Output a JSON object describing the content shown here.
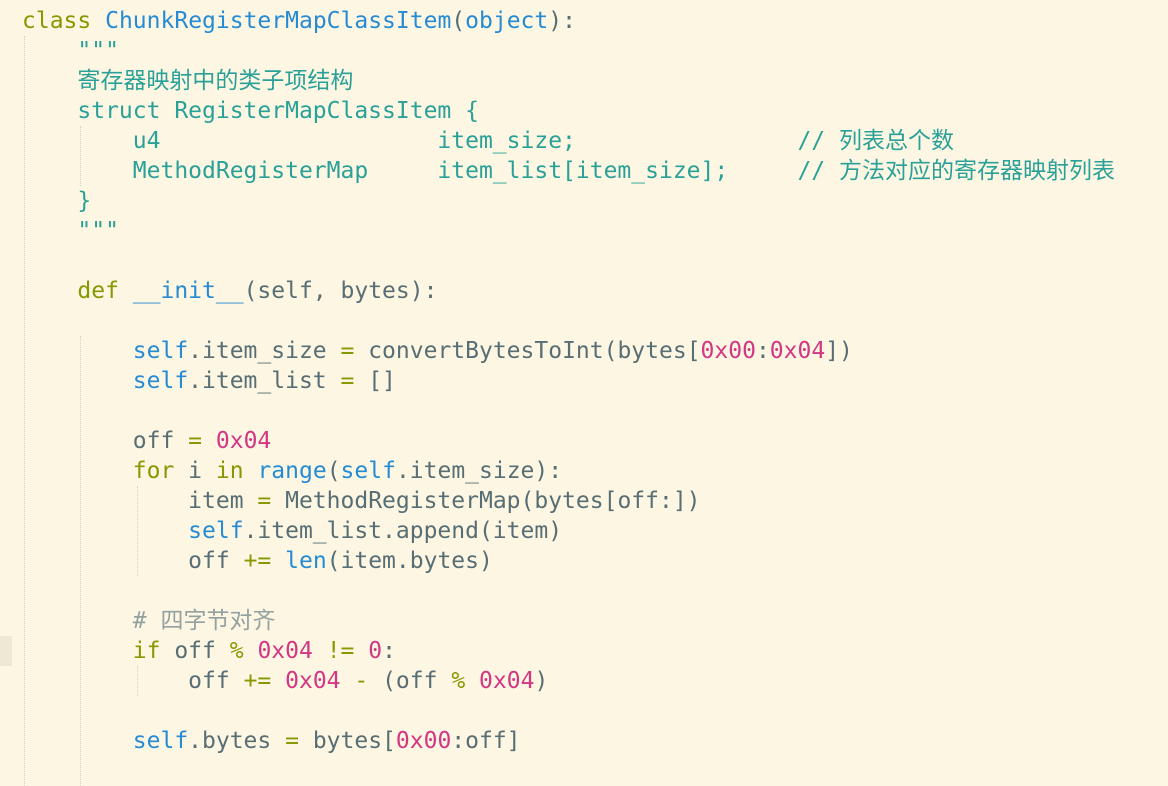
{
  "editor": {
    "theme_colors": {
      "background": "#fdf6e3",
      "keyword": "#859900",
      "function": "#268bd2",
      "number": "#d33682",
      "docstring": "#2aa198",
      "comment": "#93a1a1",
      "text": "#586e75"
    },
    "lines": [
      [
        [
          "kw",
          "class"
        ],
        [
          "txt",
          " "
        ],
        [
          "cls",
          "ChunkRegisterMapClassItem"
        ],
        [
          "txt",
          "("
        ],
        [
          "bi",
          "object"
        ],
        [
          "txt",
          "):"
        ]
      ],
      [
        [
          "txt",
          "    "
        ],
        [
          "doc",
          "\"\"\""
        ]
      ],
      [
        [
          "txt",
          "    "
        ],
        [
          "doc",
          "寄存器映射中的类子项结构"
        ]
      ],
      [
        [
          "txt",
          "    "
        ],
        [
          "doc",
          "struct RegisterMapClassItem {"
        ]
      ],
      [
        [
          "txt",
          "        "
        ],
        [
          "doc",
          "u4                    item_size;                // 列表总个数"
        ]
      ],
      [
        [
          "txt",
          "        "
        ],
        [
          "doc",
          "MethodRegisterMap     item_list[item_size];     // 方法对应的寄存器映射列表"
        ]
      ],
      [
        [
          "txt",
          "    "
        ],
        [
          "doc",
          "}"
        ]
      ],
      [
        [
          "txt",
          "    "
        ],
        [
          "doc",
          "\"\"\""
        ]
      ],
      [],
      [
        [
          "txt",
          "    "
        ],
        [
          "kw",
          "def"
        ],
        [
          "txt",
          " "
        ],
        [
          "fn",
          "__init__"
        ],
        [
          "txt",
          "(self, bytes):"
        ]
      ],
      [],
      [
        [
          "txt",
          "        "
        ],
        [
          "self",
          "self"
        ],
        [
          "txt",
          ".item_size "
        ],
        [
          "op",
          "="
        ],
        [
          "txt",
          " convertBytesToInt(bytes["
        ],
        [
          "num",
          "0x00"
        ],
        [
          "txt",
          ":"
        ],
        [
          "num",
          "0x04"
        ],
        [
          "txt",
          "])"
        ]
      ],
      [
        [
          "txt",
          "        "
        ],
        [
          "self",
          "self"
        ],
        [
          "txt",
          ".item_list "
        ],
        [
          "op",
          "="
        ],
        [
          "txt",
          " []"
        ]
      ],
      [],
      [
        [
          "txt",
          "        off "
        ],
        [
          "op",
          "="
        ],
        [
          "txt",
          " "
        ],
        [
          "num",
          "0x04"
        ]
      ],
      [
        [
          "txt",
          "        "
        ],
        [
          "kw",
          "for"
        ],
        [
          "txt",
          " i "
        ],
        [
          "kw",
          "in"
        ],
        [
          "txt",
          " "
        ],
        [
          "bi",
          "range"
        ],
        [
          "txt",
          "("
        ],
        [
          "self",
          "self"
        ],
        [
          "txt",
          ".item_size):"
        ]
      ],
      [
        [
          "txt",
          "            item "
        ],
        [
          "op",
          "="
        ],
        [
          "txt",
          " MethodRegisterMap(bytes[off:])"
        ]
      ],
      [
        [
          "txt",
          "            "
        ],
        [
          "self",
          "self"
        ],
        [
          "txt",
          ".item_list.append(item)"
        ]
      ],
      [
        [
          "txt",
          "            off "
        ],
        [
          "op",
          "+="
        ],
        [
          "txt",
          " "
        ],
        [
          "bi",
          "len"
        ],
        [
          "txt",
          "(item.bytes)"
        ]
      ],
      [],
      [
        [
          "txt",
          "        "
        ],
        [
          "cmt",
          "# 四字节对齐"
        ]
      ],
      [
        [
          "txt",
          "        "
        ],
        [
          "kw",
          "if"
        ],
        [
          "txt",
          " off "
        ],
        [
          "op",
          "%"
        ],
        [
          "txt",
          " "
        ],
        [
          "num",
          "0x04"
        ],
        [
          "txt",
          " "
        ],
        [
          "op",
          "!="
        ],
        [
          "txt",
          " "
        ],
        [
          "num",
          "0"
        ],
        [
          "txt",
          ":"
        ]
      ],
      [
        [
          "txt",
          "            off "
        ],
        [
          "op",
          "+="
        ],
        [
          "txt",
          " "
        ],
        [
          "num",
          "0x04"
        ],
        [
          "txt",
          " "
        ],
        [
          "op",
          "-"
        ],
        [
          "txt",
          " (off "
        ],
        [
          "op",
          "%"
        ],
        [
          "txt",
          " "
        ],
        [
          "num",
          "0x04"
        ],
        [
          "txt",
          ")"
        ]
      ],
      [],
      [
        [
          "txt",
          "        "
        ],
        [
          "self",
          "self"
        ],
        [
          "txt",
          ".bytes "
        ],
        [
          "op",
          "="
        ],
        [
          "txt",
          " bytes["
        ],
        [
          "num",
          "0x00"
        ],
        [
          "txt",
          ":off]"
        ]
      ]
    ]
  }
}
